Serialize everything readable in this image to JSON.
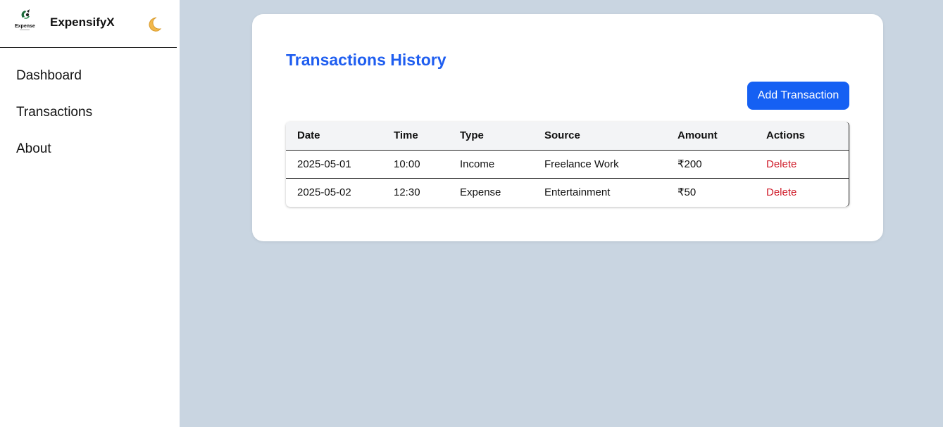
{
  "app": {
    "brand_name": "ExpensifyX",
    "logo_text": "Expense",
    "theme_icon": "moon-icon"
  },
  "sidebar": {
    "items": [
      {
        "label": "Dashboard"
      },
      {
        "label": "Transactions"
      },
      {
        "label": "About"
      }
    ]
  },
  "main": {
    "title": "Transactions History",
    "add_button_label": "Add Transaction",
    "table": {
      "headers": [
        "Date",
        "Time",
        "Type",
        "Source",
        "Amount",
        "Actions"
      ],
      "rows": [
        {
          "date": "2025-05-01",
          "time": "10:00",
          "type": "Income",
          "source": "Freelance Work",
          "amount": "₹200",
          "action": "Delete"
        },
        {
          "date": "2025-05-02",
          "time": "12:30",
          "type": "Expense",
          "source": "Entertainment",
          "amount": "₹50",
          "action": "Delete"
        }
      ]
    }
  },
  "colors": {
    "accent": "#1560f3",
    "title": "#1f5ef0",
    "danger": "#d01c2a",
    "background": "#c9d5e1"
  }
}
